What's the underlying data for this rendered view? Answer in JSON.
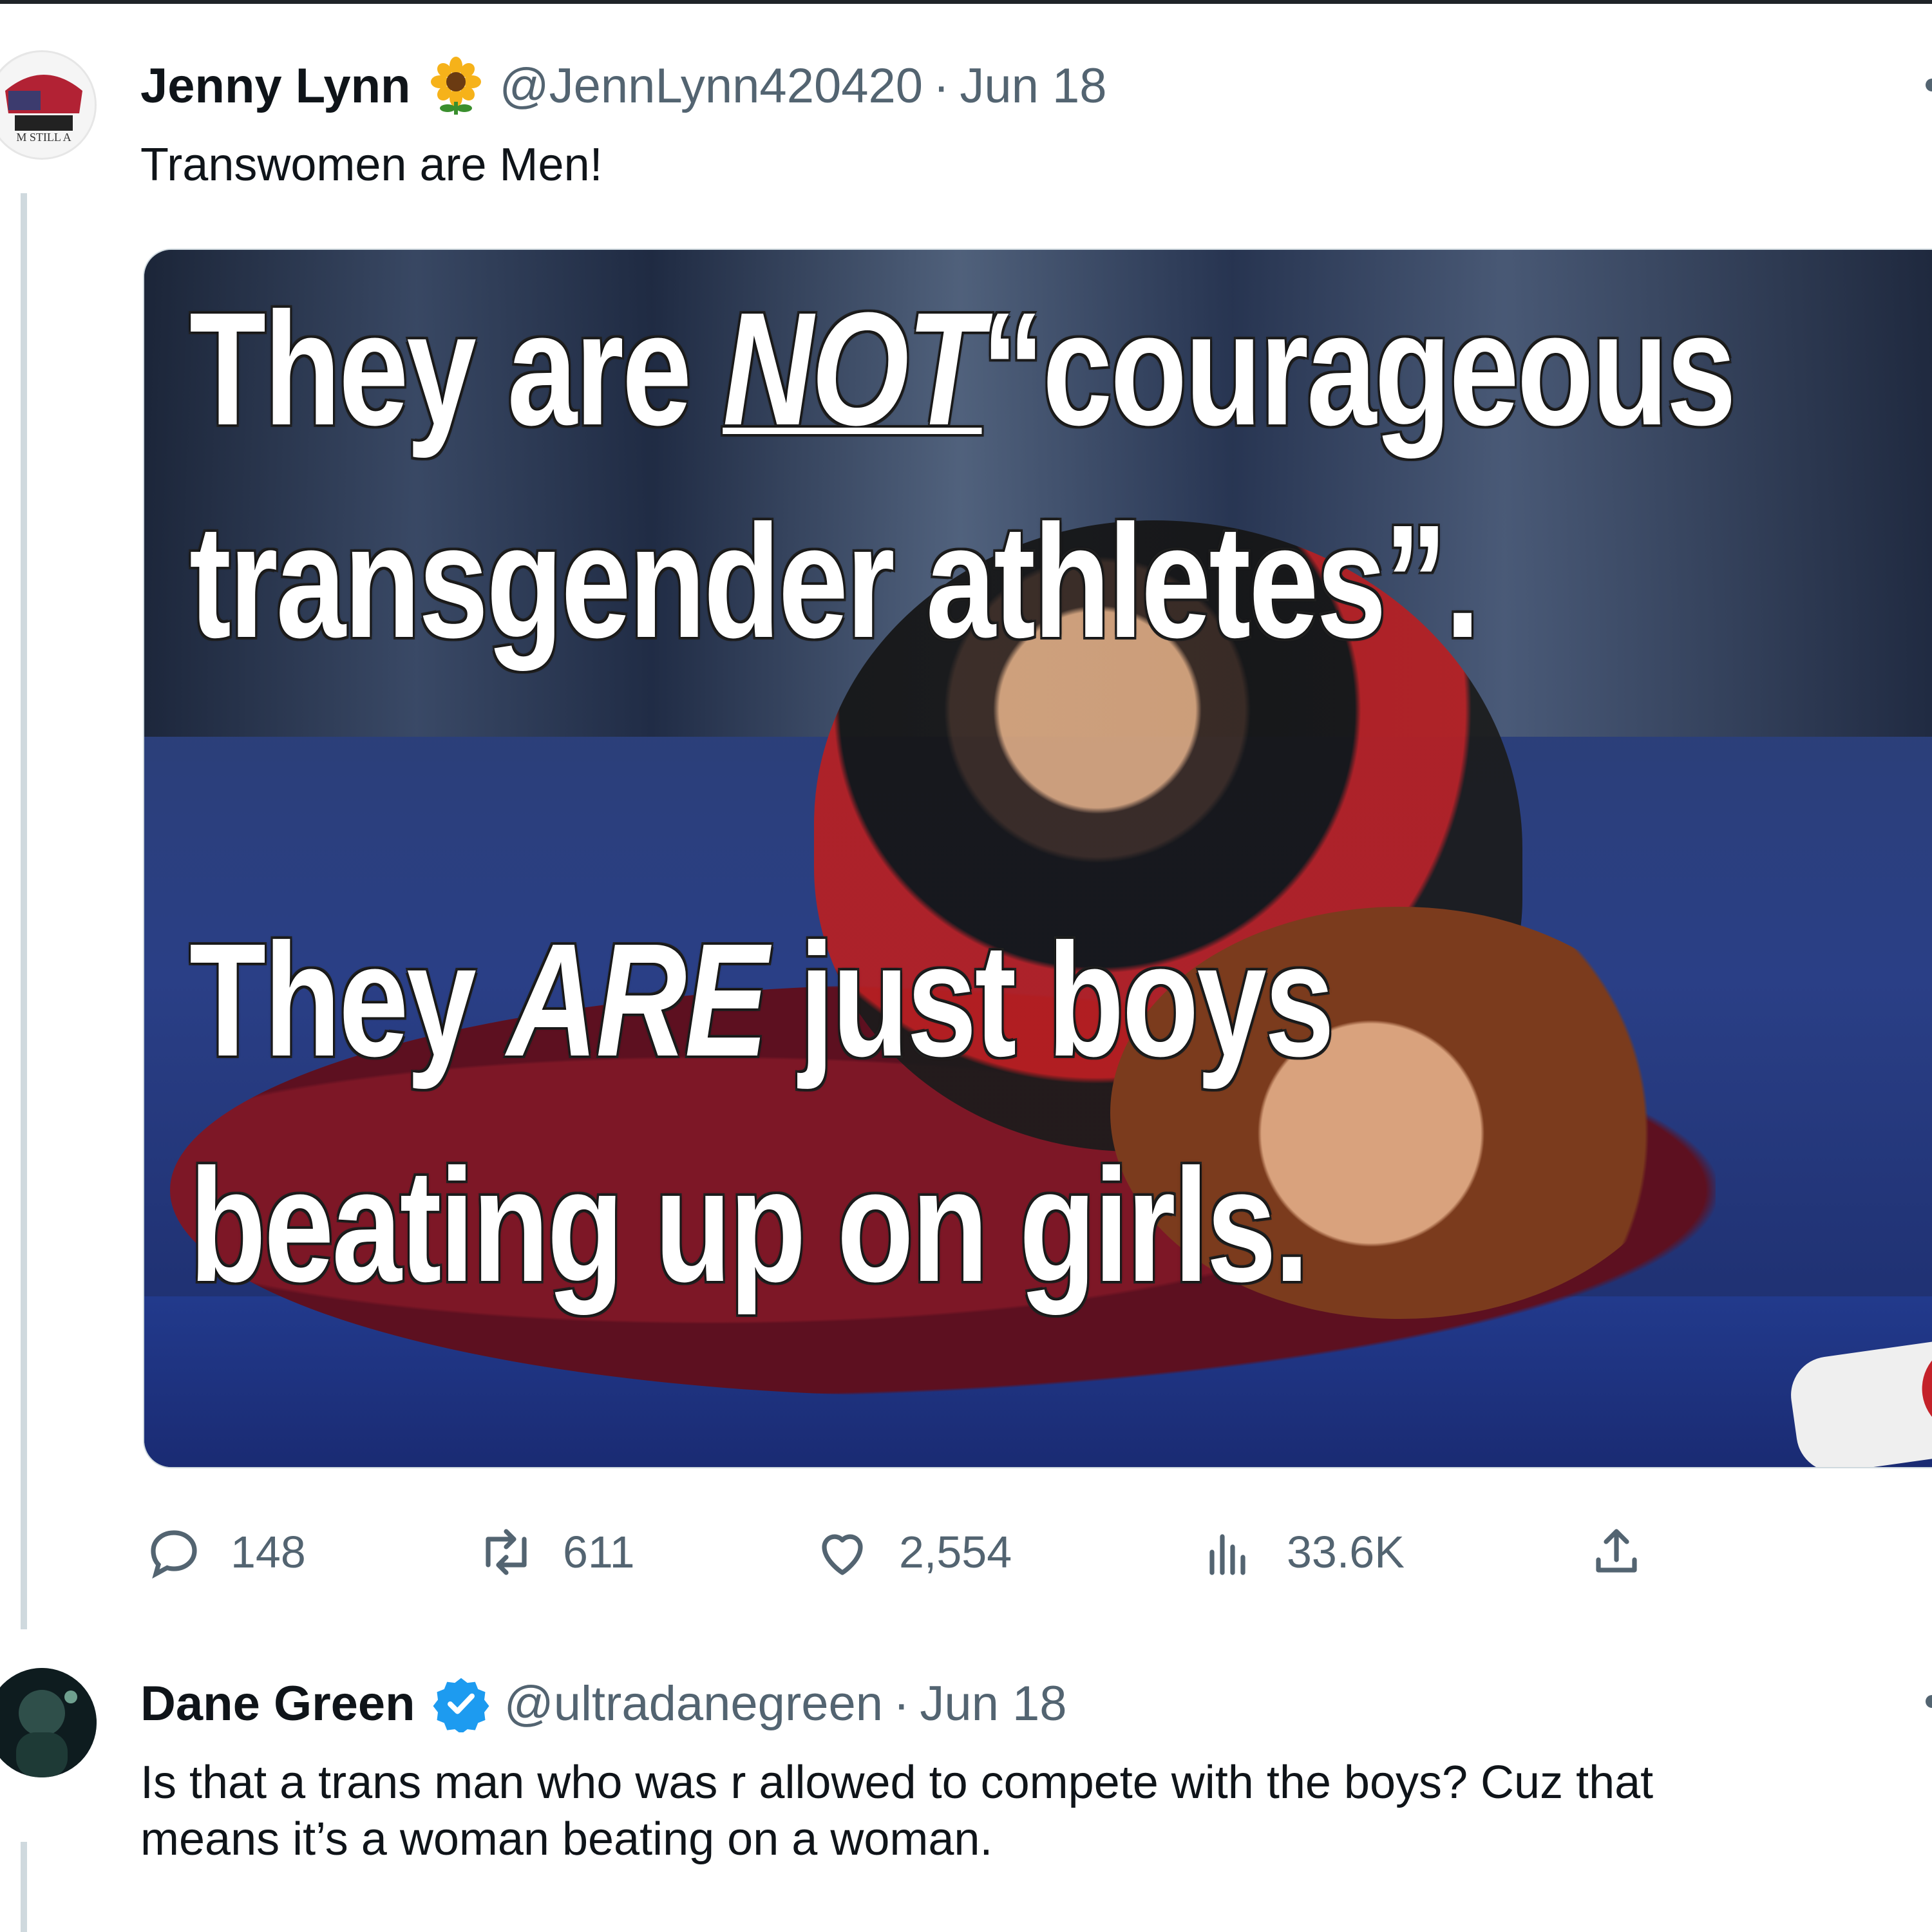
{
  "tweets": [
    {
      "name": "Jenny Lynn",
      "handle": "@JennLynn420420",
      "separator": "·",
      "date": "Jun 18",
      "text": "Transwomen are Men!",
      "badge_icon": "sunflower-icon",
      "media": {
        "lines": {
          "l1_a": "They are ",
          "l1_b": "NOT",
          "l1_c": "“courageous",
          "l2": "transgender athletes”.",
          "l3_a": "They ",
          "l3_b": "ARE",
          "l3_c": " just boys",
          "l4": "beating up on girls."
        }
      },
      "actions": {
        "replies": "148",
        "retweets": "611",
        "likes": "2,554",
        "views": "33.6K"
      }
    },
    {
      "name": "Dane Green",
      "handle": "@ultradanegreen",
      "separator": "·",
      "date": "Jun 18",
      "badge_icon": "verified-badge-icon",
      "text_line1": "Is that a trans man who was r allowed to compete with the boys? Cuz that",
      "text_line2": "means it’s a woman beating on a woman."
    }
  ],
  "colors": {
    "secondary_text": "#536471",
    "verified_blue": "#1d9bf0",
    "thread_line": "#cfd9de"
  }
}
